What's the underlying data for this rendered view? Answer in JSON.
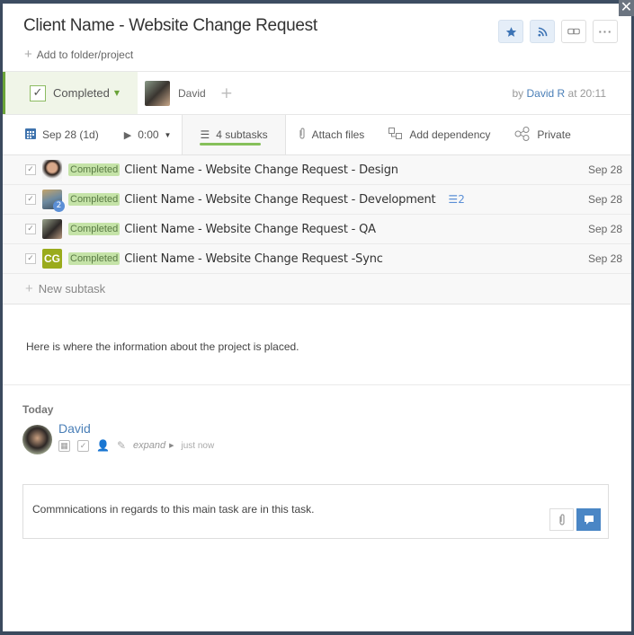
{
  "window": {
    "close_label": "✕"
  },
  "header": {
    "title": "Client Name - Website Change Request",
    "add_folder_label": "Add to folder/project",
    "buttons": [
      {
        "name": "star",
        "icon": "star-icon"
      },
      {
        "name": "follow",
        "icon": "rss-icon"
      },
      {
        "name": "link",
        "icon": "link-icon"
      },
      {
        "name": "more",
        "icon": "more-icon"
      }
    ]
  },
  "status": {
    "label": "Completed",
    "assignee": "David",
    "by_prefix": "by",
    "author": "David R",
    "time_text": "at 20:11",
    "accent_color": "#6aa338"
  },
  "toolbar": {
    "date": "Sep 28 (1d)",
    "time_tracked": "0:00",
    "subtasks": "4 subtasks",
    "attach": "Attach files",
    "dependency": "Add dependency",
    "privacy": "Private"
  },
  "subtasks": [
    {
      "status": "Completed",
      "title": "Client Name - Website Change Request - Design",
      "date": "Sep 28",
      "avatar": "photo"
    },
    {
      "status": "Completed",
      "title": "Client Name - Website Change Request - Development",
      "date": "Sep 28",
      "avatar": "photo",
      "assignee_badge": "2",
      "subtask_count": "2"
    },
    {
      "status": "Completed",
      "title": "Client Name - Website Change Request - QA",
      "date": "Sep 28",
      "avatar": "photo"
    },
    {
      "status": "Completed",
      "title": "Client Name - Website Change Request -Sync",
      "date": "Sep 28",
      "avatar": "initials",
      "initials": "CG"
    }
  ],
  "new_subtask_label": "New subtask",
  "description": "Here is where the information about the project is placed.",
  "activity": {
    "day_label": "Today",
    "author": "David",
    "expand_label": "expand",
    "time": "just now"
  },
  "comment": {
    "text": "Commnications in regards to this main task are in this task."
  }
}
